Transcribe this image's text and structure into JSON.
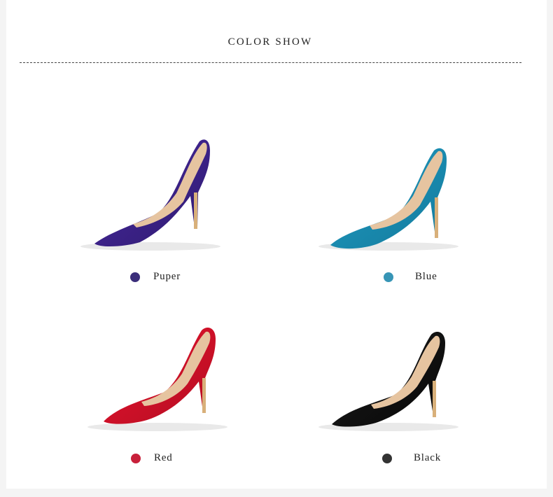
{
  "section": {
    "title": "COLOR SHOW"
  },
  "colors": [
    {
      "name": "Puper",
      "swatch": "#3b2e7a",
      "shoe": "#4a2aa0",
      "shade": "#2e1a70"
    },
    {
      "name": "Blue",
      "swatch": "#3795b6",
      "shoe": "#1f9bc2",
      "shade": "#147a9c"
    },
    {
      "name": "Red",
      "swatch": "#c8203a",
      "shoe": "#e8142e",
      "shade": "#b30d22"
    },
    {
      "name": "Black",
      "swatch": "#333333",
      "shoe": "#1c1c1c",
      "shade": "#070707"
    }
  ]
}
